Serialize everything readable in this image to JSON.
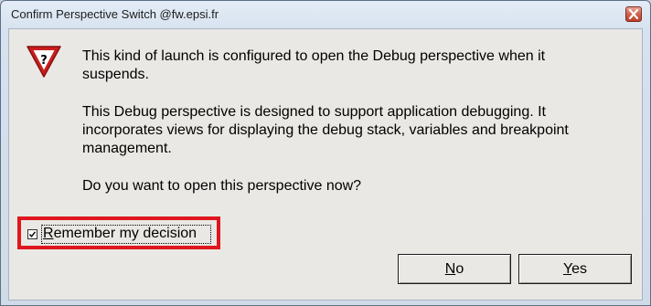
{
  "window": {
    "title": "Confirm Perspective Switch @fw.epsi.fr"
  },
  "icons": {
    "dialog_icon": "warning-question-icon",
    "close_icon": "close-icon"
  },
  "message": {
    "paragraph1": "This kind of launch is configured to open the Debug perspective when it\nsuspends.",
    "paragraph2": "This Debug perspective is designed to support application debugging.  It\nincorporates views for displaying the debug stack, variables and breakpoint\nmanagement.",
    "paragraph3": "Do you want to open this perspective now?"
  },
  "checkbox": {
    "label_mnemonic": "R",
    "label_rest": "emember my decision",
    "checked": true
  },
  "buttons": {
    "no_mnemonic": "N",
    "no_rest": "o",
    "yes_mnemonic": "Y",
    "yes_rest": "es"
  },
  "colors": {
    "highlight": "#e0161e",
    "warning_red": "#c81e1e",
    "close_button": "#c0402b"
  }
}
